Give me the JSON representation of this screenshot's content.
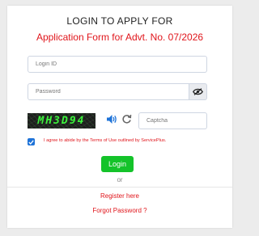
{
  "form": {
    "heading": "LOGIN TO APPLY FOR",
    "subheading": "Application Form for Advt. No. 07/2026",
    "login_id_placeholder": "Login ID",
    "password_placeholder": "Password",
    "captcha_text": "MH3D94",
    "captcha_placeholder": "Captcha",
    "agree_text": "I agree to abide by the Terms of Use outlined by ServicePlus.",
    "agree_checked": true,
    "login_label": "Login",
    "or_text": "or",
    "register_label": "Register here",
    "forgot_label": "Forgot Password ?"
  },
  "colors": {
    "accent_red": "#e0151b",
    "login_green": "#14c32a",
    "checkbox_blue": "#1e73d8",
    "captcha_green": "#3df23d"
  },
  "icons": {
    "password_toggle": "eye-slash-icon",
    "audio": "volume-icon",
    "refresh": "refresh-icon",
    "checkbox": "check-icon"
  }
}
